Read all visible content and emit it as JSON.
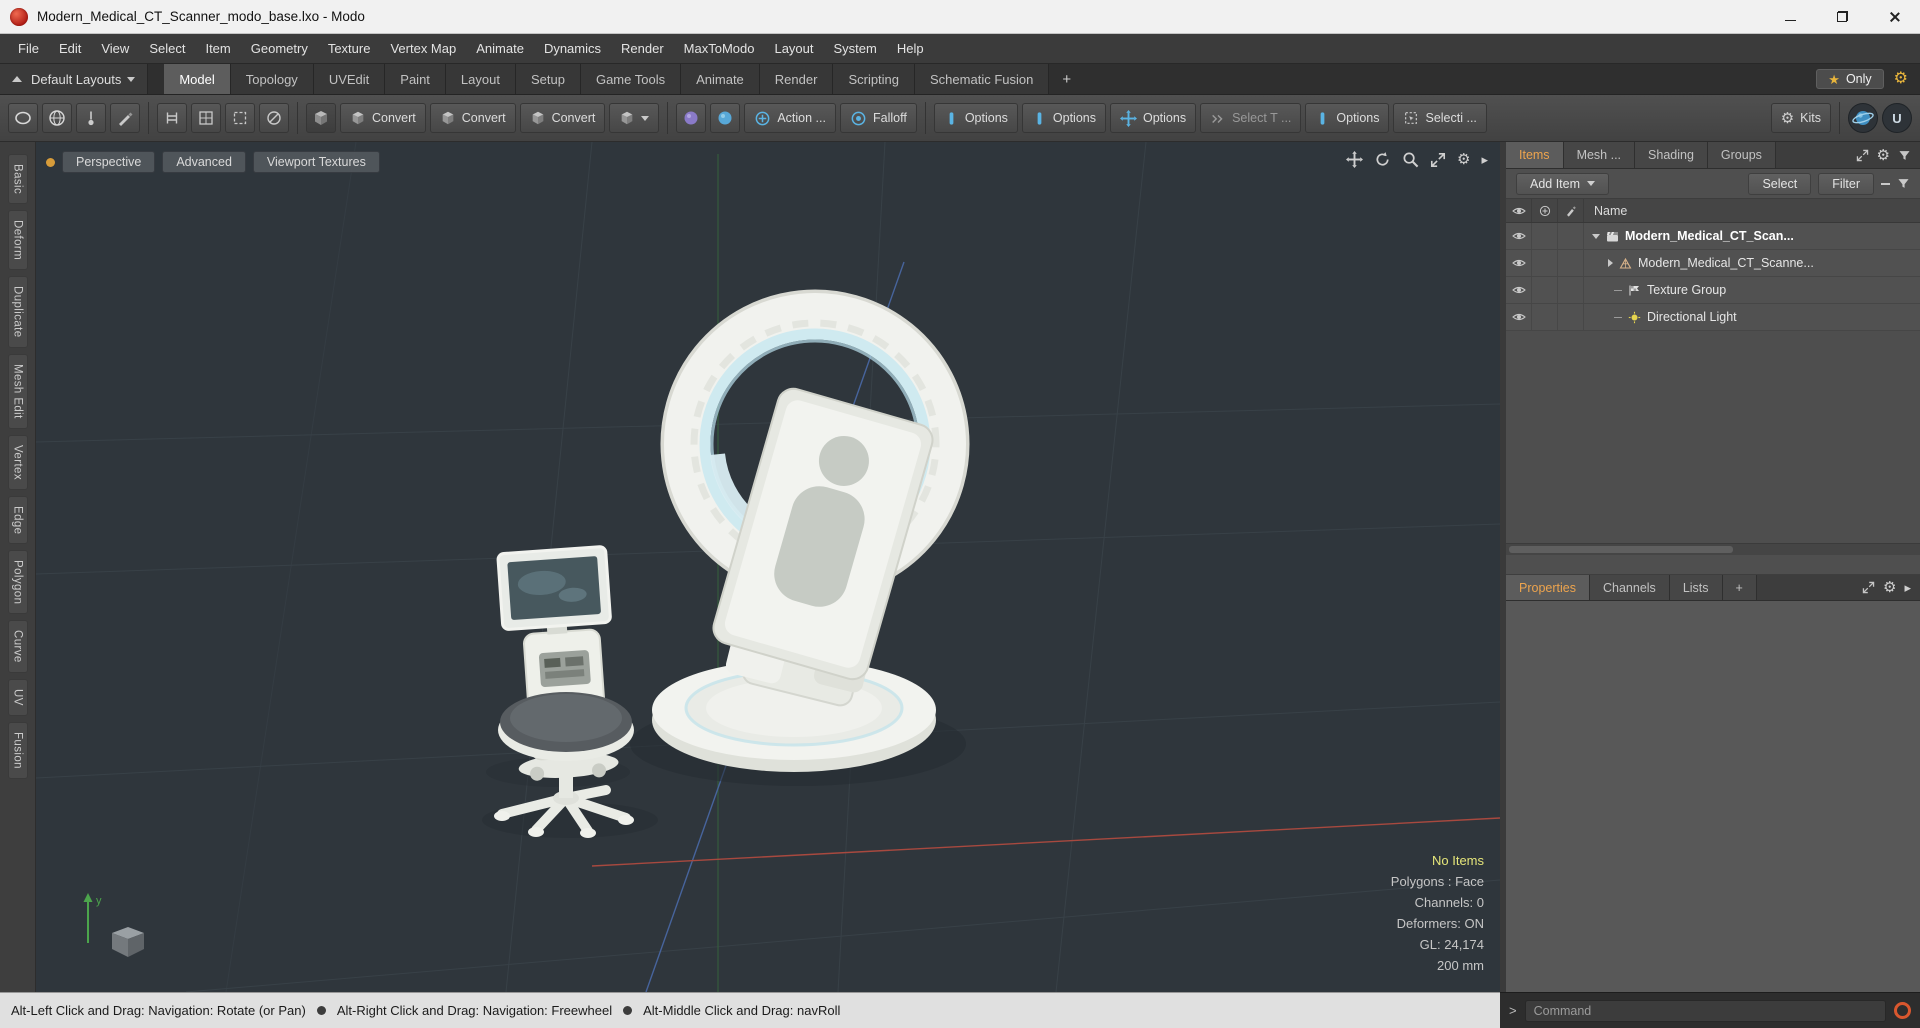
{
  "window": {
    "title": "Modern_Medical_CT_Scanner_modo_base.lxo - Modo"
  },
  "menu": {
    "items": [
      "File",
      "Edit",
      "View",
      "Select",
      "Item",
      "Geometry",
      "Texture",
      "Vertex Map",
      "Animate",
      "Dynamics",
      "Render",
      "MaxToModo",
      "Layout",
      "System",
      "Help"
    ]
  },
  "layout_bar": {
    "layout_switcher": "Default Layouts",
    "tabs": [
      "Model",
      "Topology",
      "UVEdit",
      "Paint",
      "Layout",
      "Setup",
      "Game Tools",
      "Animate",
      "Render",
      "Scripting",
      "Schematic Fusion"
    ],
    "active_tab": "Model",
    "add_tab": "+",
    "only_button": "Only"
  },
  "toolbar": {
    "buttons": [
      "Convert",
      "Convert",
      "Convert",
      "Action ...",
      "Falloff",
      "Options",
      "Options",
      "Options",
      "Select T ...",
      "Options",
      "Selecti ...",
      "Kits"
    ]
  },
  "left_tabs": [
    "Basic",
    "Deform",
    "Duplicate",
    "Mesh Edit",
    "Vertex",
    "Edge",
    "Polygon",
    "Curve",
    "UV",
    "Fusion"
  ],
  "viewport": {
    "view_buttons": [
      "Perspective",
      "Advanced",
      "Viewport Textures"
    ],
    "stats": [
      "No Items",
      "Polygons : Face",
      "Channels: 0",
      "Deformers: ON",
      "GL: 24,174",
      "200 mm"
    ],
    "axis_label": "y"
  },
  "right_panel": {
    "tabs": [
      "Items",
      "Mesh ...",
      "Shading",
      "Groups"
    ],
    "add_item_button": "Add Item",
    "select_button": "Select",
    "filter_button": "Filter",
    "columns": {
      "name": "Name"
    },
    "items": [
      {
        "name": "Modern_Medical_CT_Scan...",
        "type": "render-group"
      },
      {
        "name": "Modern_Medical_CT_Scanne...",
        "type": "mesh"
      },
      {
        "name": "Texture Group",
        "type": "texture-group"
      },
      {
        "name": "Directional Light",
        "type": "directional-light"
      }
    ],
    "lower_tabs": [
      "Properties",
      "Channels",
      "Lists",
      "+"
    ]
  },
  "status_bar": {
    "hints": [
      "Alt-Left Click and Drag: Navigation: Rotate (or Pan)",
      "Alt-Right Click and Drag: Navigation: Freewheel",
      "Alt-Middle Click and Drag: navRoll"
    ]
  },
  "command_bar": {
    "prompt": ">",
    "placeholder": "Command"
  },
  "icons": {
    "star": "★",
    "gear": "⚙",
    "arrow_right": "▸"
  },
  "colors": {
    "viewport_bg": "#2f363c",
    "accent_orange": "#eda44e",
    "axis_red": "#a8493f",
    "axis_green": "#35593c",
    "axis_blue": "#47649c",
    "ring_cyan": "#cfeaf0",
    "warning_yellow": "#e6e67a"
  }
}
